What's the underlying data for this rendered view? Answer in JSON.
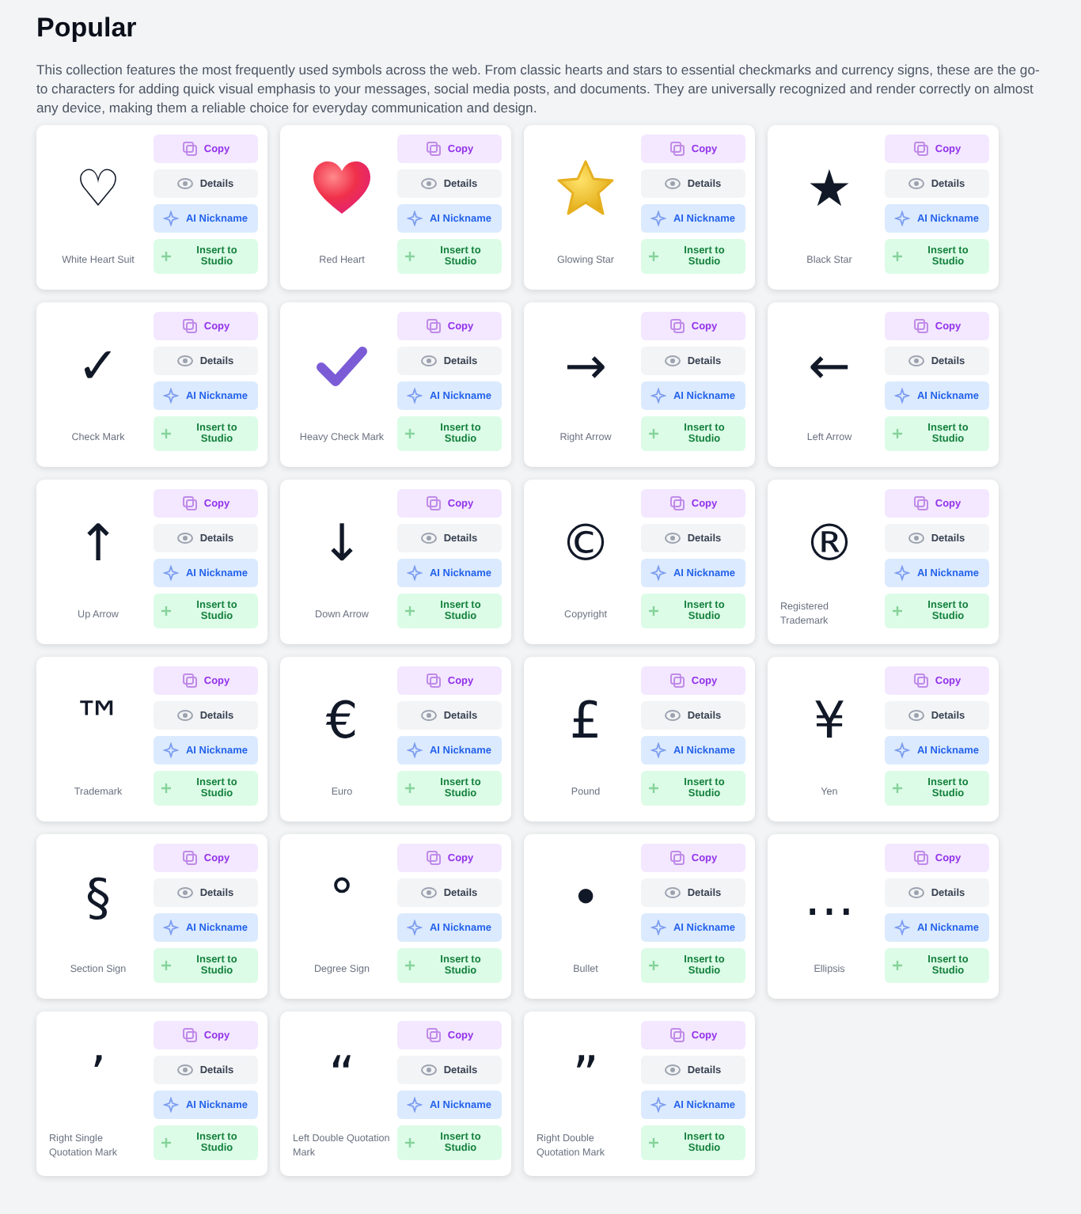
{
  "title": "Popular",
  "description": "This collection features the most frequently used symbols across the web. From classic hearts and stars to essential checkmarks and currency signs, these are the go-to characters for adding quick visual emphasis to your messages, social media posts, and documents. They are universally recognized and render correctly on almost any device, making them a reliable choice for everyday communication and design.",
  "symbols": [
    {
      "kind": "glyph",
      "symbol": "♡",
      "name": "White Heart Suit",
      "buttons": [
        "Copy",
        "Details",
        "AI Nickname",
        "Insert to Studio"
      ]
    },
    {
      "kind": "heart-emoji",
      "name": "Red Heart",
      "buttons": [
        "Copy",
        "Details",
        "AI Nickname",
        "Insert to Studio"
      ]
    },
    {
      "kind": "star-emoji",
      "name": "Glowing Star",
      "buttons": [
        "Copy",
        "Details",
        "AI Nickname",
        "Insert to Studio"
      ]
    },
    {
      "kind": "glyph",
      "symbol": "★",
      "name": "Black Star",
      "buttons": [
        "Copy",
        "Details",
        "AI Nickname",
        "Insert to Studio"
      ]
    },
    {
      "kind": "glyph",
      "symbol": "✓",
      "name": "Check Mark",
      "buttons": [
        "Copy",
        "Details",
        "AI Nickname",
        "Insert to Studio"
      ]
    },
    {
      "kind": "check-emoji",
      "name": "Heavy Check Mark",
      "buttons": [
        "Copy",
        "Details",
        "AI Nickname",
        "Insert to Studio"
      ]
    },
    {
      "kind": "glyph",
      "symbol": "→",
      "name": "Right Arrow",
      "buttons": [
        "Copy",
        "Details",
        "AI Nickname",
        "Insert to Studio"
      ]
    },
    {
      "kind": "glyph",
      "symbol": "←",
      "name": "Left Arrow",
      "buttons": [
        "Copy",
        "Details",
        "AI Nickname",
        "Insert to Studio"
      ]
    },
    {
      "kind": "glyph",
      "symbol": "↑",
      "name": "Up Arrow",
      "buttons": [
        "Copy",
        "Details",
        "AI Nickname",
        "Insert to Studio"
      ]
    },
    {
      "kind": "glyph",
      "symbol": "↓",
      "name": "Down Arrow",
      "buttons": [
        "Copy",
        "Details",
        "AI Nickname",
        "Insert to Studio"
      ]
    },
    {
      "kind": "glyph",
      "symbol": "©",
      "name": "Copyright",
      "buttons": [
        "Copy",
        "Details",
        "AI Nickname",
        "Insert to Studio"
      ]
    },
    {
      "kind": "glyph",
      "symbol": "®",
      "name": "Registered Trademark",
      "buttons": [
        "Copy",
        "Details",
        "AI Nickname",
        "Insert to Studio"
      ]
    },
    {
      "kind": "glyph",
      "symbol": "™",
      "name": "Trademark",
      "buttons": [
        "Copy",
        "Details",
        "AI Nickname",
        "Insert to Studio"
      ]
    },
    {
      "kind": "glyph",
      "symbol": "€",
      "name": "Euro",
      "buttons": [
        "Copy",
        "Details",
        "AI Nickname",
        "Insert to Studio"
      ]
    },
    {
      "kind": "glyph",
      "symbol": "£",
      "name": "Pound",
      "buttons": [
        "Copy",
        "Details",
        "AI Nickname",
        "Insert to Studio"
      ]
    },
    {
      "kind": "glyph",
      "symbol": "¥",
      "name": "Yen",
      "buttons": [
        "Copy",
        "Details",
        "AI Nickname",
        "Insert to Studio"
      ]
    },
    {
      "kind": "glyph",
      "symbol": "§",
      "name": "Section Sign",
      "buttons": [
        "Copy",
        "Details",
        "AI Nickname",
        "Insert to Studio"
      ]
    },
    {
      "kind": "glyph",
      "symbol": "°",
      "name": "Degree Sign",
      "buttons": [
        "Copy",
        "Details",
        "AI Nickname",
        "Insert to Studio"
      ]
    },
    {
      "kind": "glyph",
      "symbol": "•",
      "name": "Bullet",
      "buttons": [
        "Copy",
        "Details",
        "AI Nickname",
        "Insert to Studio"
      ]
    },
    {
      "kind": "glyph",
      "symbol": "…",
      "name": "Ellipsis",
      "buttons": [
        "Copy",
        "Details",
        "AI Nickname",
        "Insert to Studio"
      ]
    },
    {
      "kind": "glyph",
      "symbol": "’",
      "name": "Right Single Quotation Mark",
      "buttons": [
        "Copy",
        "Details",
        "AI Nickname",
        "Insert to Studio"
      ]
    },
    {
      "kind": "glyph",
      "symbol": "“",
      "name": "Left Double Quotation Mark",
      "buttons": [
        "Copy",
        "Details",
        "AI Nickname",
        "Insert to Studio"
      ]
    },
    {
      "kind": "glyph",
      "symbol": "”",
      "name": "Right Double Quotation Mark",
      "buttons": [
        "Copy",
        "Details",
        "AI Nickname",
        "Insert to Studio"
      ]
    }
  ]
}
